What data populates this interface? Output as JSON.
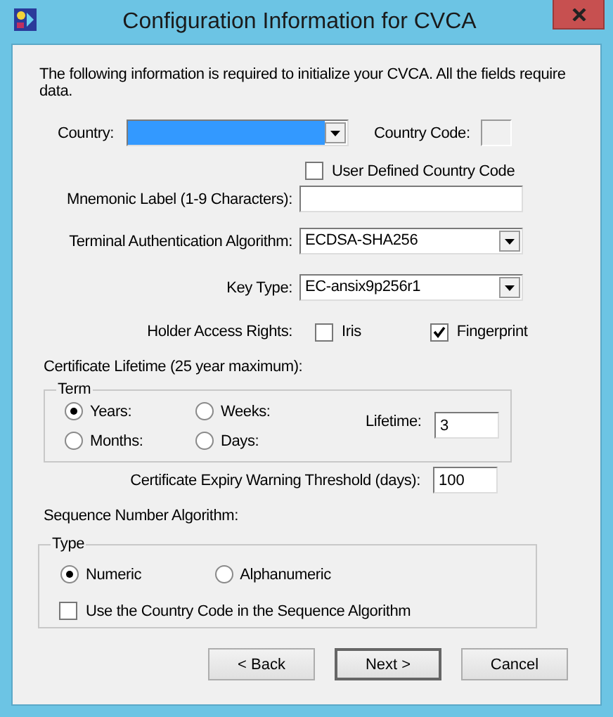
{
  "window": {
    "title": "Configuration Information for CVCA"
  },
  "intro": "The following information is required to initialize your CVCA.  All the fields require data.",
  "country": {
    "label": "Country:",
    "highlighted": true
  },
  "country_code": {
    "label": "Country Code:"
  },
  "user_defined": {
    "label": "User Defined Country Code",
    "checked": false
  },
  "mnemonic": {
    "label": "Mnemonic Label (1-9 Characters):"
  },
  "algorithm": {
    "label": "Terminal Authentication Algorithm:",
    "value": "ECDSA-SHA256"
  },
  "key_type": {
    "label": "Key Type:",
    "value": "EC-ansix9p256r1"
  },
  "holder_access": {
    "label": "Holder Access Rights:",
    "options": [
      {
        "label": "Iris",
        "checked": false
      },
      {
        "label": "Fingerprint",
        "checked": true
      }
    ]
  },
  "lifetime": {
    "label": "Certificate Lifetime (25 year maximum):",
    "group": "Term",
    "units": [
      {
        "label": "Years:",
        "selected": true
      },
      {
        "label": "Weeks:",
        "selected": false
      },
      {
        "label": "Months:",
        "selected": false
      },
      {
        "label": "Days:",
        "selected": false
      }
    ],
    "value_label": "Lifetime:",
    "value": "3"
  },
  "expiry": {
    "label": "Certificate Expiry Warning Threshold (days):",
    "value": "100"
  },
  "sequence": {
    "label": "Sequence Number Algorithm:",
    "group": "Type",
    "types": [
      {
        "label": "Numeric",
        "selected": true
      },
      {
        "label": "Alphanumeric",
        "selected": false
      }
    ],
    "use_country_code": {
      "label": "Use the Country Code in the Sequence Algorithm",
      "checked": false
    }
  },
  "buttons": [
    {
      "label": "< Back",
      "default": false
    },
    {
      "label": "Next >",
      "default": true
    },
    {
      "label": "Cancel",
      "default": false
    }
  ]
}
